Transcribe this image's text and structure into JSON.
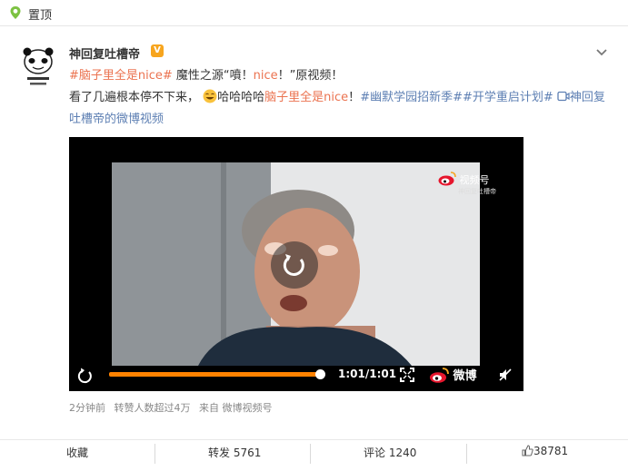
{
  "top": {
    "label": "置顶"
  },
  "author": {
    "name": "神回复吐槽帝",
    "badge": "V"
  },
  "post": {
    "hashtag1": "#脑子里全是nice#",
    "text1": " 魔性之源“噴！",
    "nice1": "nice",
    "text2": "！”原视频！",
    "text3": "看了几遍根本停不下来，",
    "text4": "哈哈哈哈",
    "hashtag_inline": "脑子里全是nice",
    "text5": "！",
    "topic1": "#幽默学园招新季#",
    "topic2": "#开学重启计划#",
    "link": "神回复吐槽帝的微博视频"
  },
  "video": {
    "watermark_title": "视频号",
    "watermark_sub": "神回复吐槽帝",
    "time": "1:01/1:01",
    "weibo_label": "微博",
    "progress": 1.0
  },
  "meta": {
    "time": "2分钟前",
    "shares": "转赞人数超过4万",
    "source": "来自 微博视频号"
  },
  "actions": {
    "collect": "收藏",
    "repost": "转发 5761",
    "comment": "评论 1240",
    "like": "38781"
  },
  "colors": {
    "accent": "#ff8200",
    "tag": "#eb7350",
    "link": "#5d7fb3"
  }
}
